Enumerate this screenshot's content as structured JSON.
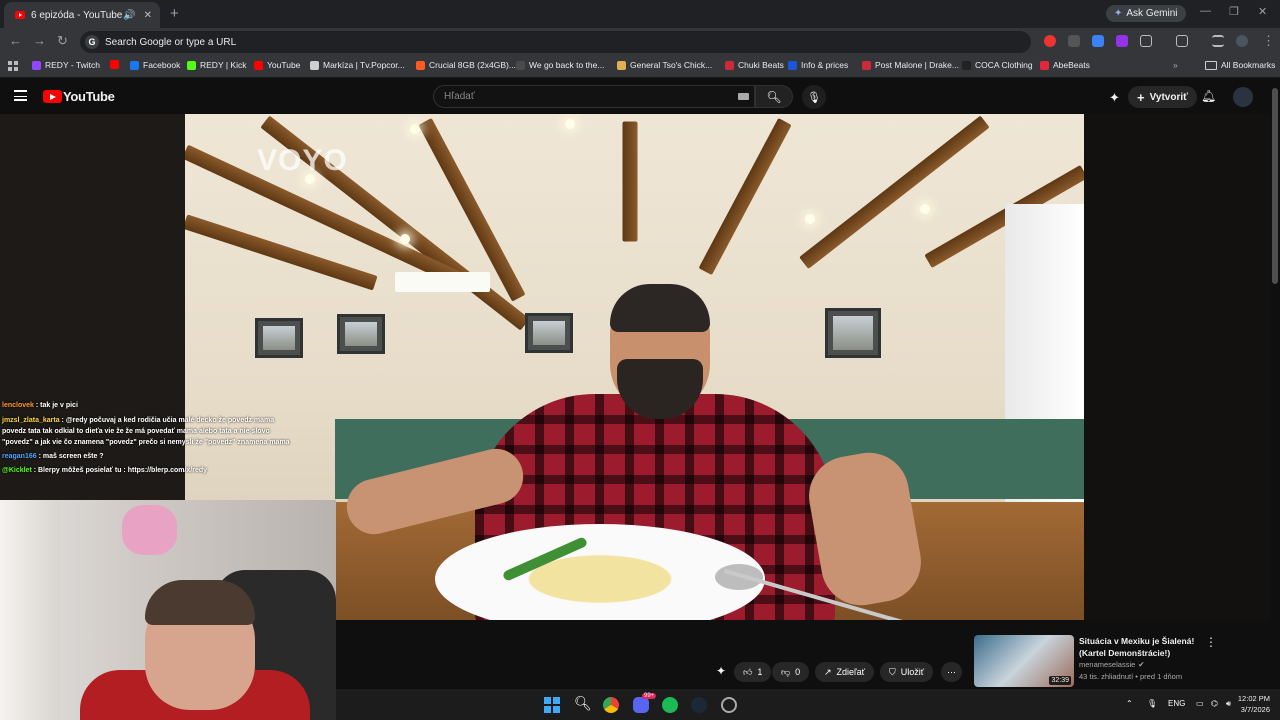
{
  "browser": {
    "tab_title": "6 epizóda - YouTube",
    "ask_gemini": "Ask Gemini",
    "omnibox_placeholder": "Search Google or type a URL",
    "bookmarks": [
      {
        "label": "REDY - Twitch",
        "color": "#9146ff"
      },
      {
        "label": "",
        "color": "#ff0000"
      },
      {
        "label": "Facebook",
        "color": "#1877f2"
      },
      {
        "label": "REDY | Kick",
        "color": "#53fc18"
      },
      {
        "label": "YouTube",
        "color": "#ff0000"
      },
      {
        "label": "Markíza | Tv.Popcor...",
        "color": "#cfcfcf"
      },
      {
        "label": "Crucial 8GB (2x4GB)...",
        "color": "#ff5a1f"
      },
      {
        "label": "We go back to the...",
        "color": "#4a4a4a"
      },
      {
        "label": "General Tso's Chick...",
        "color": "#e0b050"
      },
      {
        "label": "Chuki Beats",
        "color": "#cc2a3a"
      },
      {
        "label": "Info & prices",
        "color": "#1a56db"
      },
      {
        "label": "Post Malone | Drake...",
        "color": "#cc2a3a"
      },
      {
        "label": "COCA Clothing",
        "color": "#222222"
      },
      {
        "label": "AbeBeats",
        "color": "#e3263a"
      }
    ],
    "all_bookmarks": "All Bookmarks"
  },
  "youtube": {
    "logo": "YouTube",
    "search_placeholder": "Hľadať",
    "create_label": "Vytvoriť",
    "watermark": "VOYO",
    "actions": {
      "like_count": "1",
      "dislike_count": "0",
      "share": "Zdieľať",
      "save": "Uložiť"
    },
    "recommended": {
      "title_line1": "Situácia v Mexiku je Šialená!",
      "title_line2": "(Kartel Demonštrácie!)",
      "channel": "menameselassie",
      "meta": "43 tis. zhliadnutí • pred 1 dňom",
      "duration": "32:39"
    }
  },
  "chat": [
    {
      "user": "lenclovek",
      "text": " : tak je v pici",
      "color": "#ff9a2e"
    },
    {
      "user": "jmzsl_zlata_karta",
      "text": " : @redy počuvaj a ked rodičia učia malé decko že povedz mama",
      "color": "#ffd54a"
    },
    {
      "user": "",
      "text": "povedz tata tak odkial to dieťa vie že že má povedať mama alebo tata a nie slovo",
      "color": "#ffffff"
    },
    {
      "user": "",
      "text": "\"povedz\" a jak vie čo znamena \"povedz\" prečo si nemysli že \"povedz\" znamena mama",
      "color": "#ffffff"
    },
    {
      "user": "reagan166",
      "text": " : maš screen ešte  ?",
      "color": "#4fa3ff"
    },
    {
      "user": "@Kicklet",
      "text": " : Blerpy môžeš posielať tu : https://blerp.com/x/redy",
      "color": "#53fc18"
    }
  ],
  "taskbar": {
    "language": "ENG",
    "time": "12:02 PM",
    "date": "3/7/2026",
    "discord_badge": "99+"
  }
}
